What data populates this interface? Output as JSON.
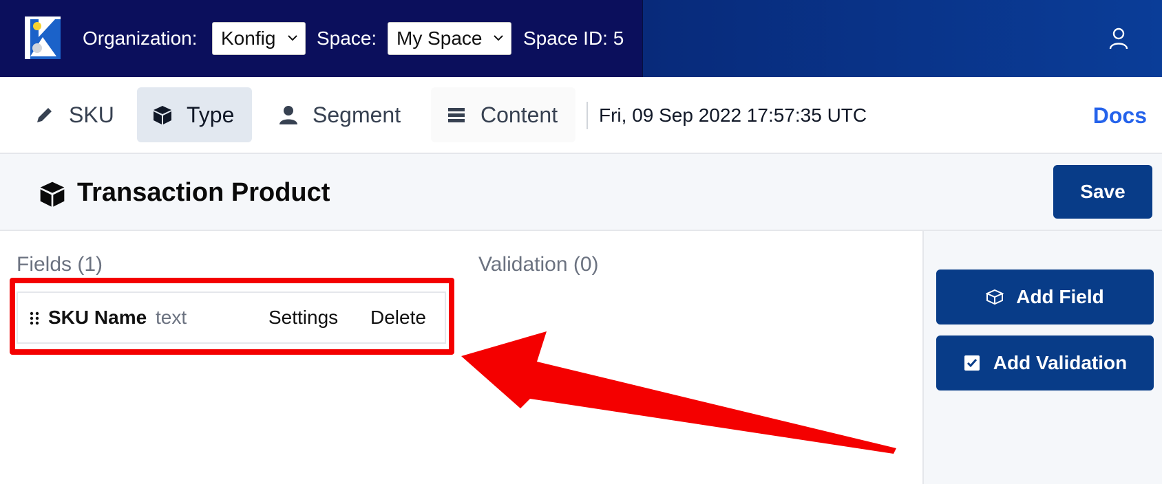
{
  "topbar": {
    "org_label": "Organization:",
    "org_value": "Konfig",
    "space_label": "Space:",
    "space_value": "My Space",
    "space_id": "Space ID: 5"
  },
  "nav": {
    "tabs": [
      {
        "label": "SKU",
        "icon": "pencil-icon"
      },
      {
        "label": "Type",
        "icon": "cube-icon",
        "active": true
      },
      {
        "label": "Segment",
        "icon": "person-icon"
      },
      {
        "label": "Content",
        "icon": "list-icon"
      }
    ],
    "datetime": "Fri, 09 Sep 2022 17:57:35 UTC",
    "docs": "Docs"
  },
  "header": {
    "title": "Transaction Product",
    "save": "Save"
  },
  "fields": {
    "heading": "Fields (1)",
    "items": [
      {
        "name": "SKU Name",
        "type": "text",
        "settings": "Settings",
        "delete": "Delete"
      }
    ]
  },
  "validation": {
    "heading": "Validation (0)"
  },
  "sidebar": {
    "add_field": "Add Field",
    "add_validation": "Add Validation"
  },
  "colors": {
    "primary": "#083c88",
    "topbar": "#0b0f5c",
    "annotation": "#f40000",
    "link": "#2563eb"
  }
}
